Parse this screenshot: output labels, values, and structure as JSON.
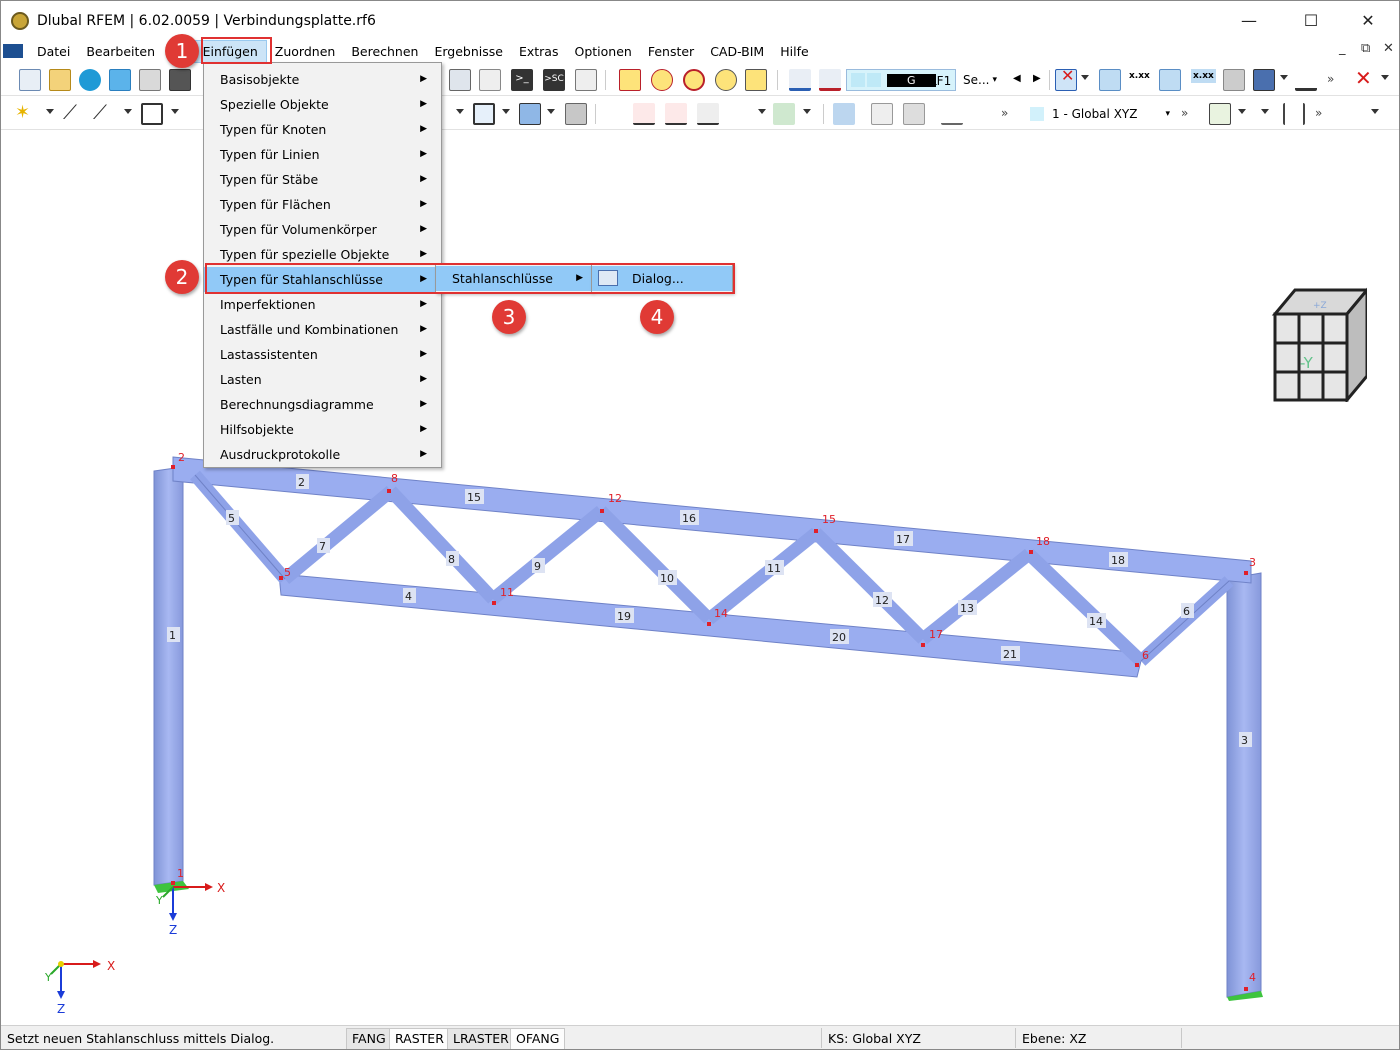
{
  "window": {
    "title": "Dlubal RFEM | 6.02.0059 | Verbindungsplatte.rf6",
    "minimize": "—",
    "maximize": "☐",
    "close": "✕"
  },
  "menubar": {
    "items": [
      "Datei",
      "Bearbeiten",
      "A",
      "Einfügen",
      "Zuordnen",
      "Berechnen",
      "Ergebnisse",
      "Extras",
      "Optionen",
      "Fenster",
      "CAD-BIM",
      "Hilfe"
    ],
    "active_index": 3,
    "mdi_minimize": "_",
    "mdi_restore": "⧉",
    "mdi_close": "✕"
  },
  "toolbar": {
    "lc_code": "G",
    "lc_name": "LF1",
    "lc_more": "Se...",
    "coord_system": "1 - Global XYZ",
    "chev": "»",
    "xxx_1": "x.xx",
    "xxx_2": "x.xx",
    "run_label": ">_",
    "sc_label": ">SC"
  },
  "menu_einfuegen": {
    "items": [
      "Basisobjekte",
      "Spezielle Objekte",
      "Typen für Knoten",
      "Typen für Linien",
      "Typen für Stäbe",
      "Typen für Flächen",
      "Typen für Volumenkörper",
      "Typen für spezielle Objekte",
      "Typen für Stahlanschlüsse",
      "Imperfektionen",
      "Lastfälle und Kombinationen",
      "Lastassistenten",
      "Lasten",
      "Berechnungsdiagramme",
      "Hilfsobjekte",
      "Ausdruckprotokolle"
    ],
    "highlight_index": 8
  },
  "submenu_stahl": {
    "label": "Stahlanschlüsse"
  },
  "submenu_dialog": {
    "label": "Dialog..."
  },
  "badges": [
    "1",
    "2",
    "3",
    "4"
  ],
  "viewcube": {
    "front": "-Y",
    "top": "+Z"
  },
  "model": {
    "node_labels": [
      "2",
      "8",
      "12",
      "15",
      "18",
      "3",
      "5",
      "11",
      "14",
      "17",
      "6",
      "1",
      "4"
    ],
    "member_labels": [
      "2",
      "15",
      "16",
      "17",
      "18",
      "5",
      "7",
      "8",
      "9",
      "10",
      "11",
      "12",
      "13",
      "14",
      "6",
      "4",
      "19",
      "20",
      "21",
      "1",
      "3"
    ],
    "axes": {
      "x": "X",
      "y": "Y",
      "z": "Z"
    }
  },
  "statusbar": {
    "message": "Setzt neuen Stahlanschluss mittels Dialog.",
    "buttons": [
      "FANG",
      "RASTER",
      "LRASTER",
      "OFANG"
    ],
    "ks": "KS: Global XYZ",
    "plane": "Ebene: XZ"
  },
  "colors": {
    "member_fill": "#9aadf0",
    "node_red": "#e0202a",
    "menu_highlight": "#91c9f7",
    "badge": "#e03a35",
    "annotation_box": "#e03131"
  }
}
